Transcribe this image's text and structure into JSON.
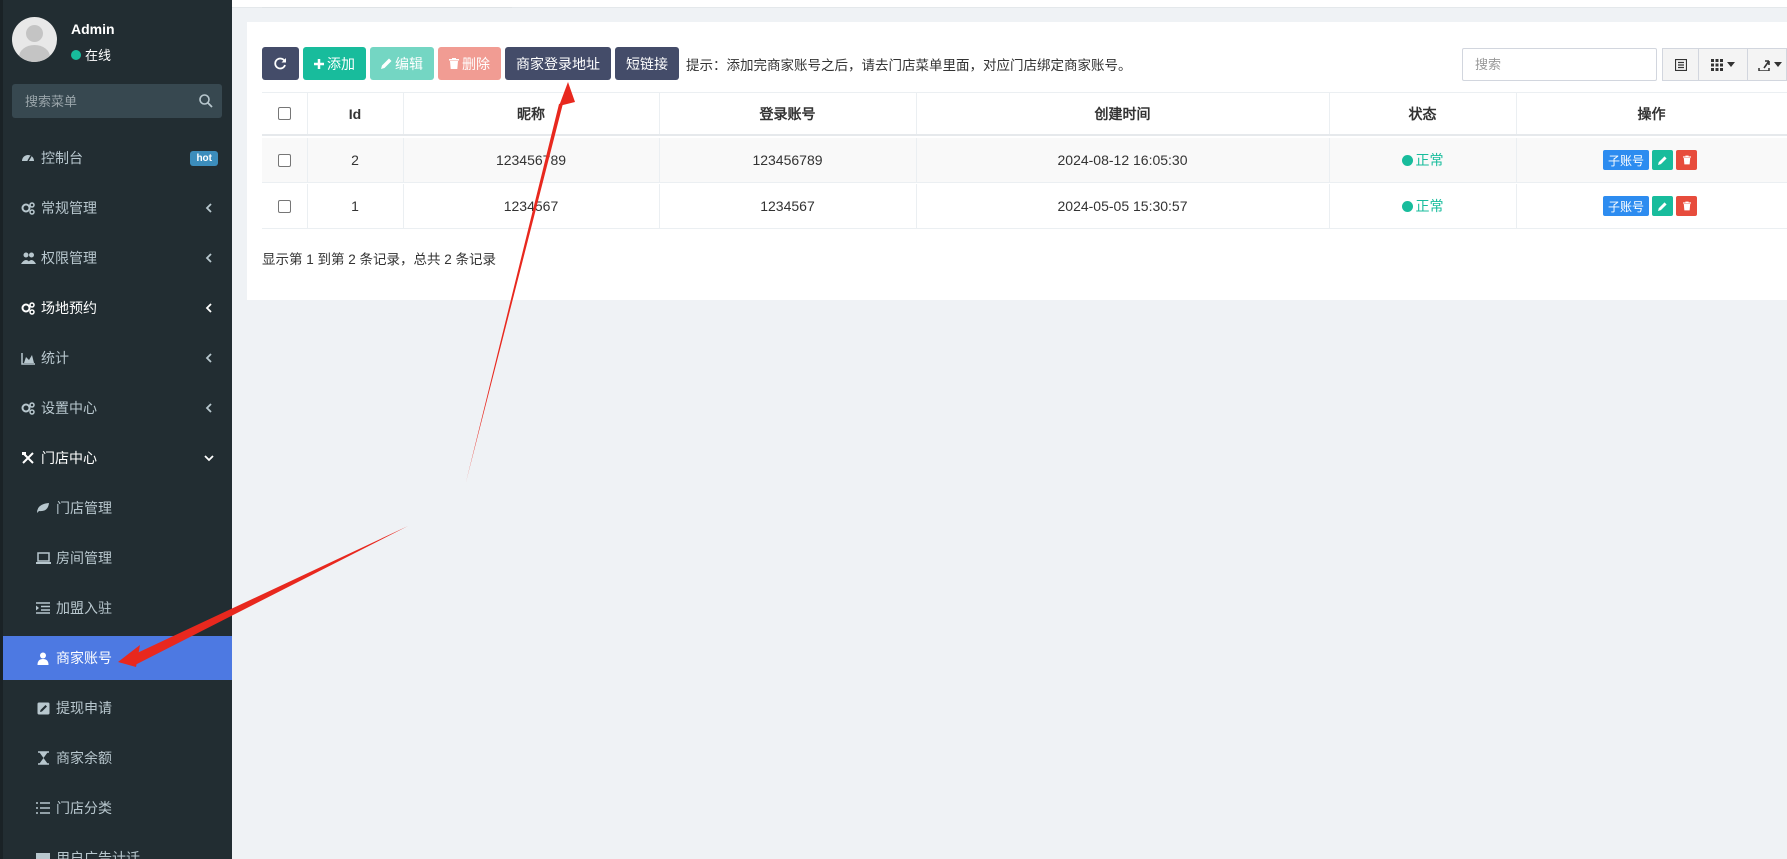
{
  "user": {
    "name": "Admin",
    "status": "在线"
  },
  "sidebar": {
    "search_placeholder": "搜索菜单",
    "items": [
      {
        "label": "控制台",
        "icon": "dashboard-icon",
        "badge": "hot"
      },
      {
        "label": "常规管理",
        "icon": "cogs-icon"
      },
      {
        "label": "权限管理",
        "icon": "group-icon"
      },
      {
        "label": "场地预约",
        "icon": "cogs-icon"
      },
      {
        "label": "统计",
        "icon": "area-chart-icon"
      },
      {
        "label": "设置中心",
        "icon": "cogs-icon"
      },
      {
        "label": "门店中心",
        "icon": "store-icon"
      },
      {
        "label": "门店管理",
        "icon": "leaf-icon"
      },
      {
        "label": "房间管理",
        "icon": "laptop-icon"
      },
      {
        "label": "加盟入驻",
        "icon": "indent-icon"
      },
      {
        "label": "商家账号",
        "icon": "user-icon"
      },
      {
        "label": "提现申请",
        "icon": "edit-icon"
      },
      {
        "label": "商家余额",
        "icon": "hourglass-icon"
      },
      {
        "label": "门店分类",
        "icon": "list-icon"
      },
      {
        "label": "用户广告计话",
        "icon": "ad-icon"
      }
    ]
  },
  "toolbar": {
    "refresh": "",
    "add": "添加",
    "edit": "编辑",
    "delete": "删除",
    "merchant_login_url": "商家登录地址",
    "short_link": "短链接",
    "tip": "提示：添加完商家账号之后，请去门店菜单里面，对应门店绑定商家账号。",
    "search_placeholder": "搜索"
  },
  "table": {
    "headers": [
      "Id",
      "昵称",
      "登录账号",
      "创建时间",
      "状态",
      "操作"
    ],
    "rows": [
      {
        "id": "2",
        "nickname": "123456789",
        "account": "123456789",
        "created": "2024-08-12 16:05:30",
        "status": "正常",
        "sub_account": "子账号"
      },
      {
        "id": "1",
        "nickname": "1234567",
        "account": "1234567",
        "created": "2024-05-05 15:30:57",
        "status": "正常",
        "sub_account": "子账号"
      }
    ],
    "footer": "显示第 1 到第 2 条记录，总共 2 条记录"
  },
  "colors": {
    "sidebar_bg": "#222d32",
    "active": "#4d79e2",
    "success": "#18bc9c",
    "danger": "#e74c3c",
    "dark_btn": "#444c69",
    "arrow": "#e8281e"
  }
}
